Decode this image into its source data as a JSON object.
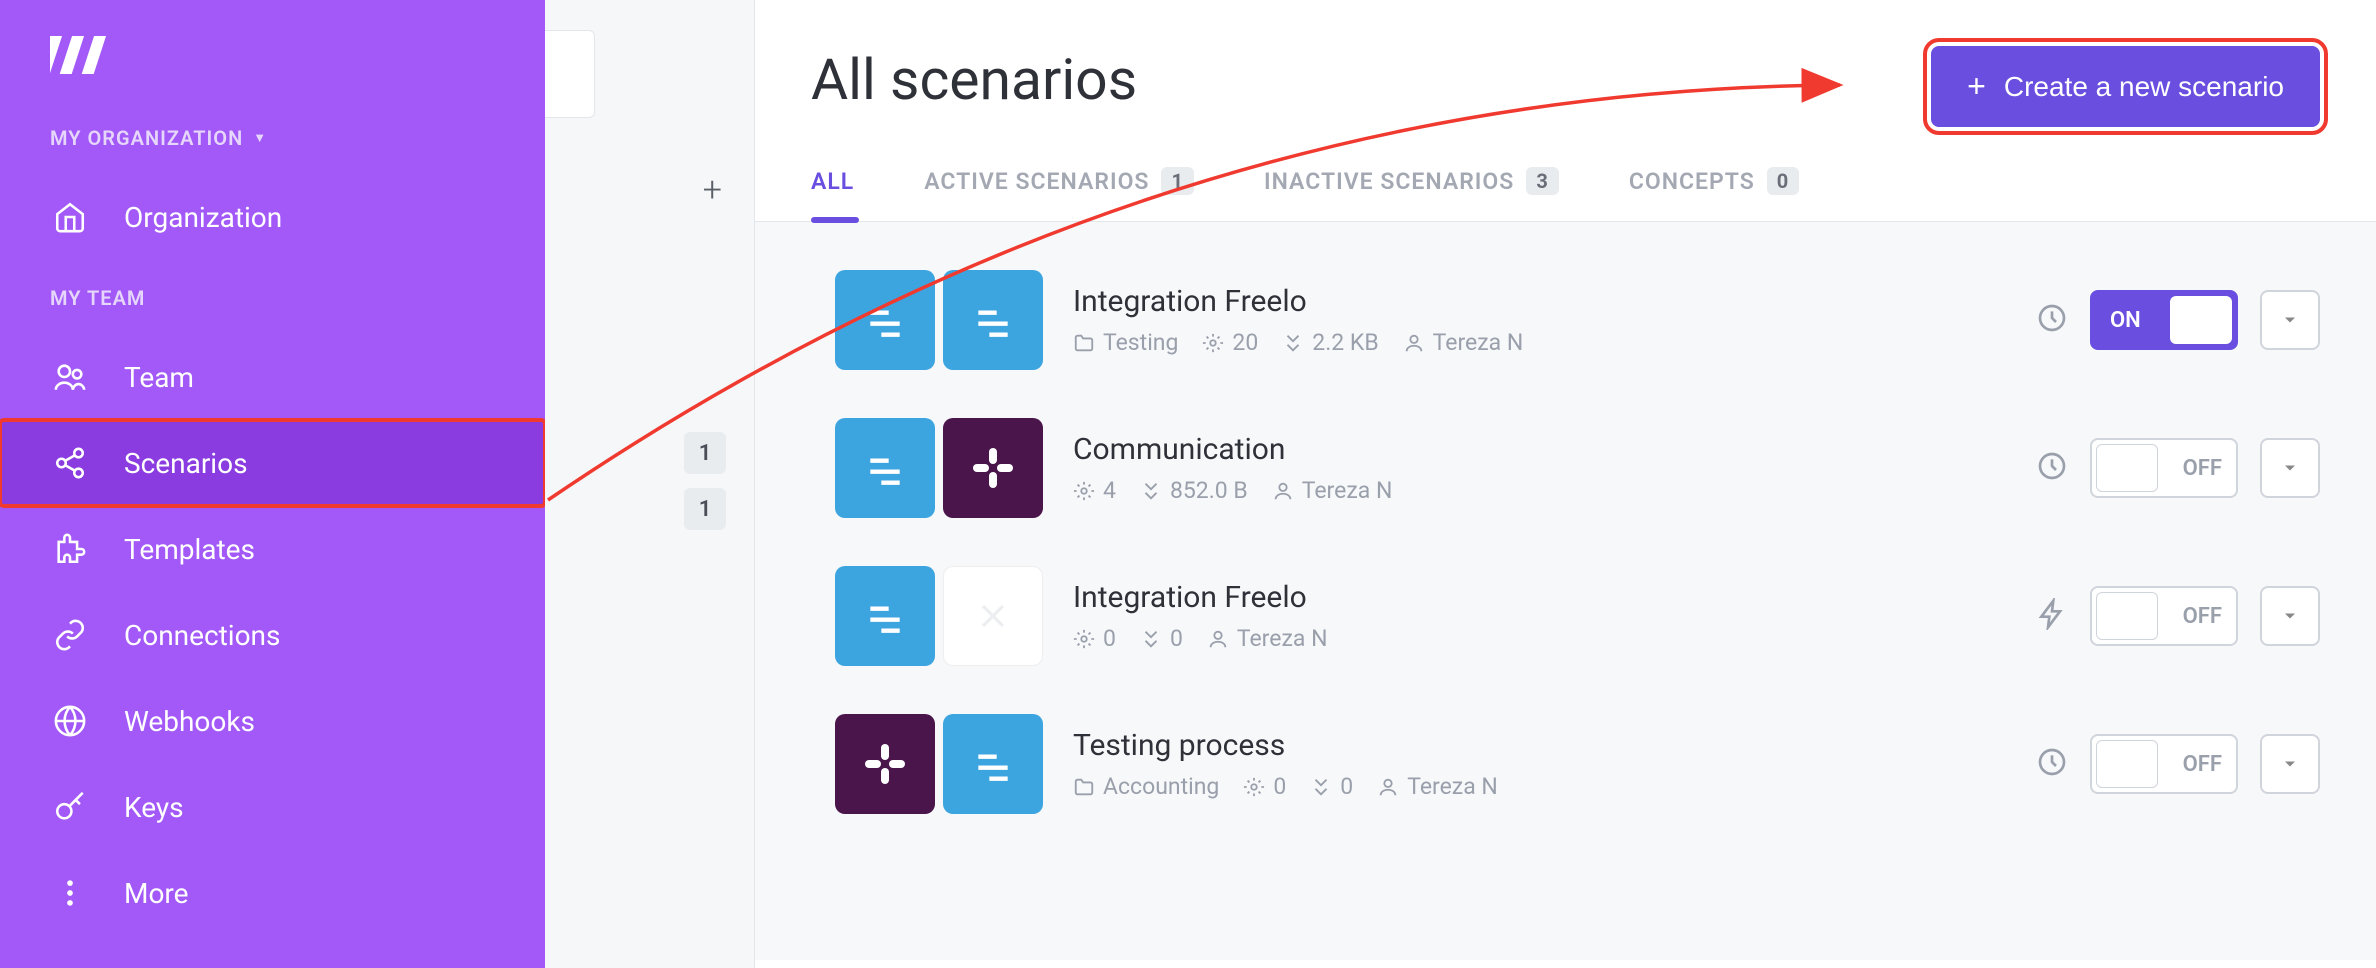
{
  "sidebar": {
    "org_label": "MY ORGANIZATION",
    "team_label": "MY TEAM",
    "items": {
      "organization": "Organization",
      "team": "Team",
      "scenarios": "Scenarios",
      "templates": "Templates",
      "connections": "Connections",
      "webhooks": "Webhooks",
      "keys": "Keys",
      "more": "More"
    }
  },
  "midstrip": {
    "badge1": "1",
    "badge2": "1",
    "plus": "+"
  },
  "header": {
    "title": "All scenarios",
    "create_label": "Create a new scenario"
  },
  "tabs": {
    "all": "ALL",
    "active": "ACTIVE SCENARIOS",
    "active_count": "1",
    "inactive": "INACTIVE SCENARIOS",
    "inactive_count": "3",
    "concepts": "CONCEPTS",
    "concepts_count": "0"
  },
  "rows": [
    {
      "title": "Integration Freelo",
      "folder": "Testing",
      "ops": "20",
      "size": "2.2 KB",
      "user": "Tereza N",
      "toggle": "ON",
      "sched": "clock"
    },
    {
      "title": "Communication",
      "folder": "",
      "ops": "4",
      "size": "852.0 B",
      "user": "Tereza N",
      "toggle": "OFF",
      "sched": "clock"
    },
    {
      "title": "Integration Freelo",
      "folder": "",
      "ops": "0",
      "size": "0",
      "user": "Tereza N",
      "toggle": "OFF",
      "sched": "bolt"
    },
    {
      "title": "Testing process",
      "folder": "Accounting",
      "ops": "0",
      "size": "0",
      "user": "Tereza N",
      "toggle": "OFF",
      "sched": "clock"
    }
  ]
}
